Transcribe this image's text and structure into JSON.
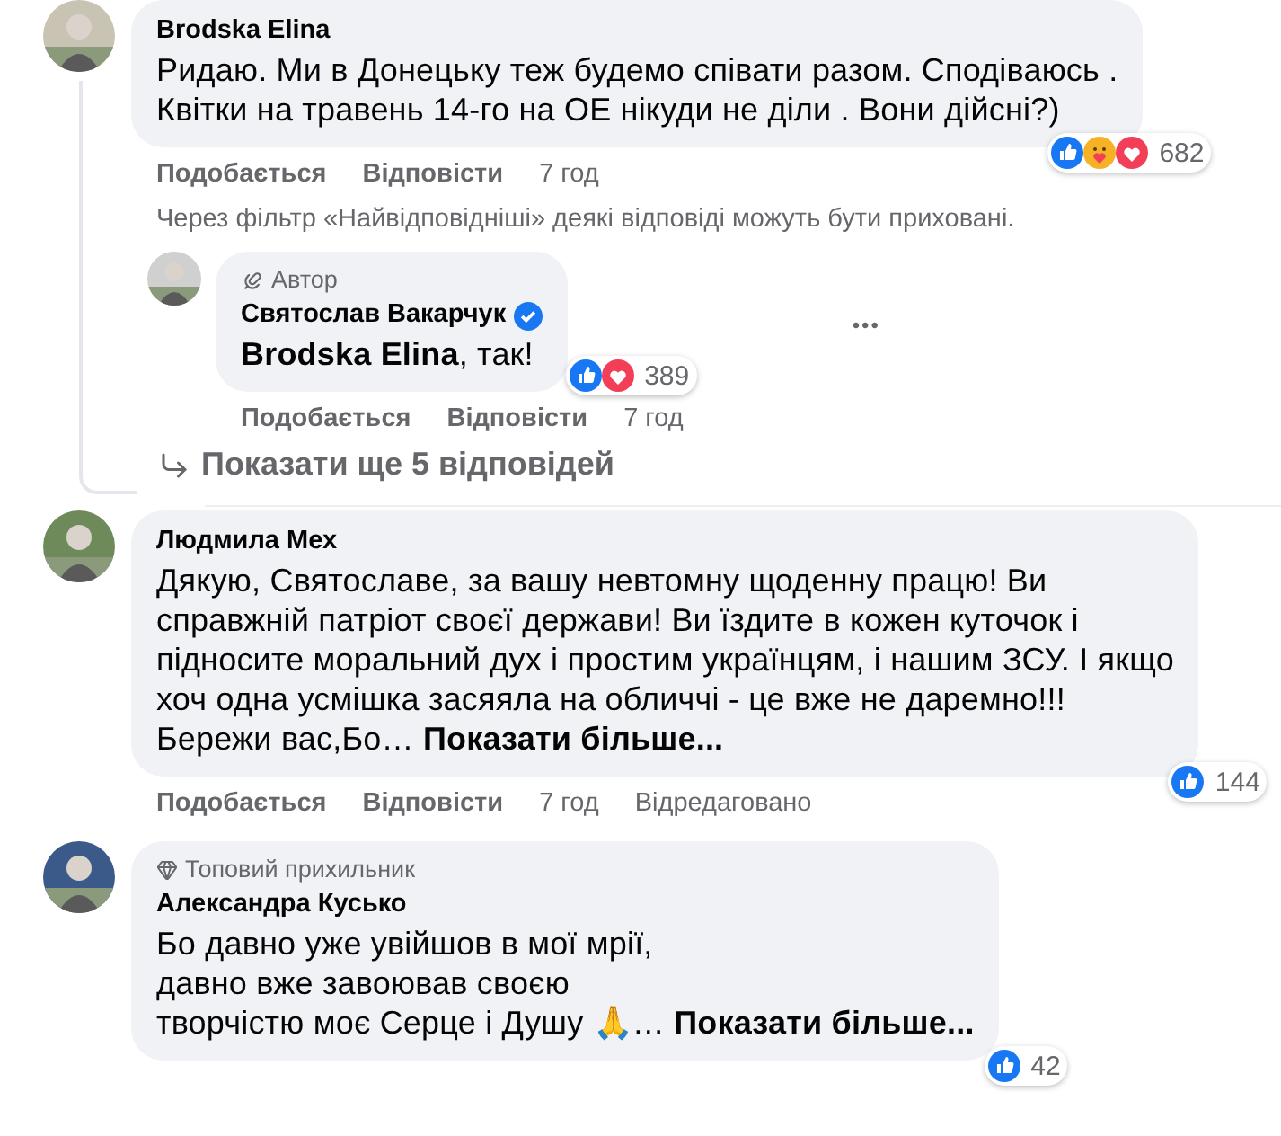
{
  "comments": [
    {
      "author": "Brodska Elina",
      "verified": false,
      "lines": [
        "Ридаю. Ми в Донецьку теж будемо співати разом. Сподіваюсь .",
        "Квітки на травень 14-го на ОЕ нікуди не діли . Вони дійсні?)"
      ],
      "reactions": {
        "icons": [
          {
            "kind": "like"
          },
          {
            "kind": "care"
          },
          {
            "kind": "love"
          }
        ],
        "count": "682"
      },
      "like": "Подобається",
      "reply": "Відповісти",
      "time": "7 год",
      "filter_note": "Через фільтр «Найвідповідніші» деякі відповіді можуть бути приховані.",
      "replies": [
        {
          "badge": {
            "kind": "author",
            "label": "Автор"
          },
          "author": "Святослав Вакарчук",
          "verified": true,
          "lines": [
            "**Brodska Elina**, так!"
          ],
          "reactions": {
            "icons": [
              {
                "kind": "like"
              },
              {
                "kind": "love"
              }
            ],
            "count": "389"
          },
          "like": "Подобається",
          "reply": "Відповісти",
          "time": "7 год",
          "menu": "•••"
        }
      ],
      "show_more_replies": "Показати ще 5 відповідей"
    },
    {
      "author": "Людмила Мех",
      "verified": false,
      "lines": [
        "Дякую, Святославе, за вашу невтомну щоденну працю! Ви",
        "справжній патріот своєї держави! Ви їздите в кожен куточок і",
        "підносите моральний дух і простим українцям, і нашим ЗСУ. І якщо",
        "хоч одна усмішка засяяла на обличчі - це вже не даремно!!!",
        "Бережи вас,Бо…"
      ],
      "more": "Показати більше...",
      "reactions": {
        "icons": [
          {
            "kind": "like"
          }
        ],
        "count": "144"
      },
      "like": "Подобається",
      "reply": "Відповісти",
      "time": "7 год",
      "edited": "Відредаговано"
    },
    {
      "badge": {
        "kind": "top_fan",
        "label": "Топовий прихильник"
      },
      "author": "Александра Кусько",
      "verified": false,
      "lines": [
        "Бо давно уже увійшов в мої мрії,",
        "давно вже завоював своєю",
        "творчістю моє Серце і Душу 🙏…"
      ],
      "more": "Показати більше...",
      "reactions": {
        "icons": [
          {
            "kind": "like"
          }
        ],
        "count": "42"
      }
    }
  ]
}
